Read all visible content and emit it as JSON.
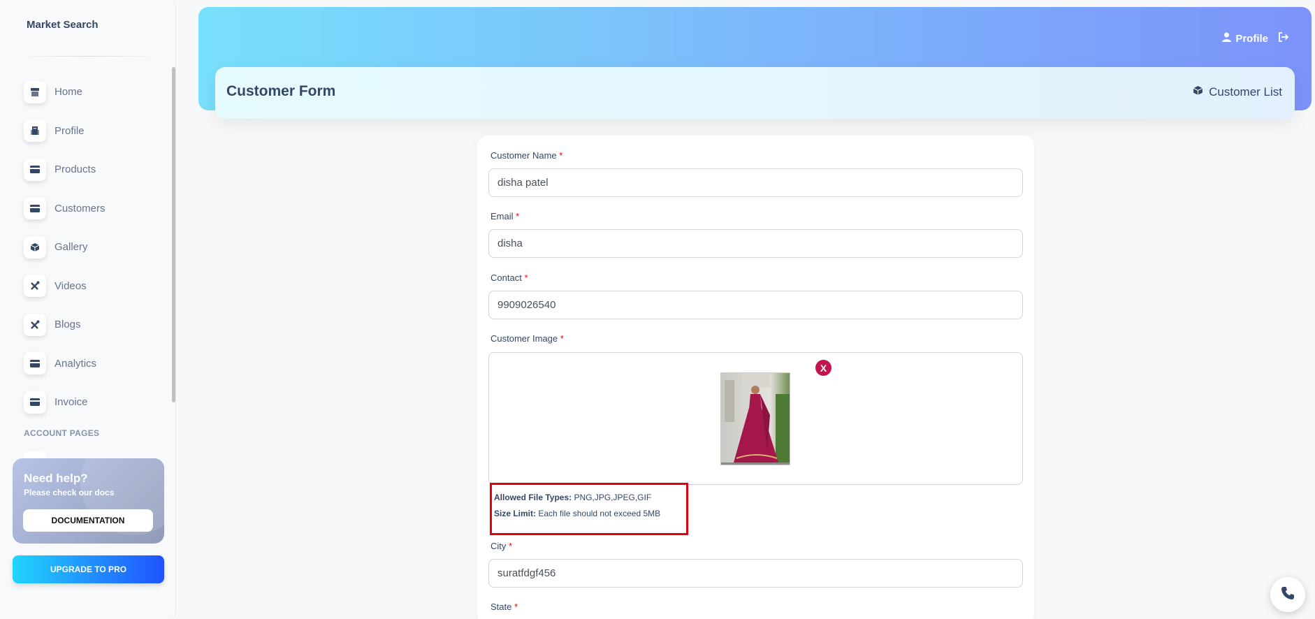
{
  "sidebar": {
    "brand": "Market Search",
    "items": [
      {
        "label": "Home",
        "icon": "shop-icon"
      },
      {
        "label": "Profile",
        "icon": "office-icon"
      },
      {
        "label": "Products",
        "icon": "credit-card-icon"
      },
      {
        "label": "Customers",
        "icon": "credit-card-icon"
      },
      {
        "label": "Gallery",
        "icon": "box-icon"
      },
      {
        "label": "Videos",
        "icon": "tools-icon"
      },
      {
        "label": "Blogs",
        "icon": "tools-icon"
      },
      {
        "label": "Analytics",
        "icon": "credit-card-icon"
      },
      {
        "label": "Invoice",
        "icon": "credit-card-icon"
      }
    ],
    "section_label": "ACCOUNT PAGES",
    "help": {
      "title": "Need help?",
      "subtitle": "Please check our docs",
      "button": "DOCUMENTATION"
    },
    "upgrade_button": "UPGRADE TO PRO"
  },
  "header": {
    "profile_label": "Profile",
    "page_title": "Customer Form",
    "list_link": "Customer List"
  },
  "form": {
    "name": {
      "label": "Customer Name",
      "required": "*",
      "value": "disha patel"
    },
    "email": {
      "label": "Email",
      "required": "*",
      "value": "disha"
    },
    "contact": {
      "label": "Contact",
      "required": "*",
      "value": "9909026540"
    },
    "image": {
      "label": "Customer Image",
      "required": "*",
      "remove": "X"
    },
    "hint": {
      "types_label": "Allowed File Types:",
      "types_value": "PNG,JPG,JPEG,GIF",
      "size_label": "Size Limit:",
      "size_value": "Each file should not exceed 5MB"
    },
    "city": {
      "label": "City",
      "required": "*",
      "value": "suratfdgf456"
    },
    "state": {
      "label": "State",
      "required": "*"
    }
  },
  "colors": {
    "header_gradient_start": "#78e0fc",
    "header_gradient_end": "#7c93fa",
    "remove_button": "#c2134d",
    "hint_border": "#e4000f",
    "required": "#ea0606"
  }
}
